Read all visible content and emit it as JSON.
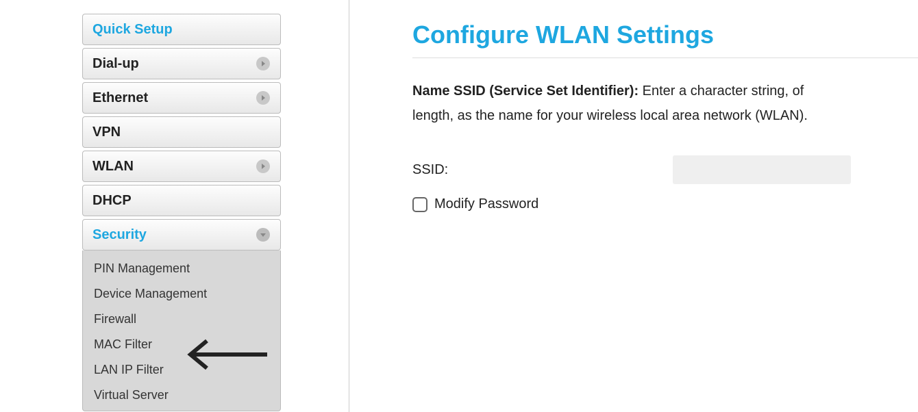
{
  "sidebar": {
    "items": [
      {
        "label": "Quick Setup",
        "active": true,
        "chevron": false
      },
      {
        "label": "Dial-up",
        "active": false,
        "chevron": true
      },
      {
        "label": "Ethernet",
        "active": false,
        "chevron": true
      },
      {
        "label": "VPN",
        "active": false,
        "chevron": false
      },
      {
        "label": "WLAN",
        "active": false,
        "chevron": true
      },
      {
        "label": "DHCP",
        "active": false,
        "chevron": false
      },
      {
        "label": "Security",
        "active": true,
        "chevron": true,
        "open": true
      }
    ],
    "security_sub": [
      "PIN Management",
      "Device Management",
      "Firewall",
      "MAC Filter",
      "LAN IP Filter",
      "Virtual Server"
    ]
  },
  "main": {
    "title": "Configure WLAN Settings",
    "desc_bold": "Name SSID (Service Set Identifier):",
    "desc_line1": "  Enter a character string, of",
    "desc_line2": "length, as the name for your wireless local area network (WLAN).",
    "ssid_label": "SSID:",
    "ssid_value": "",
    "modify_pw_label": "Modify Password"
  }
}
